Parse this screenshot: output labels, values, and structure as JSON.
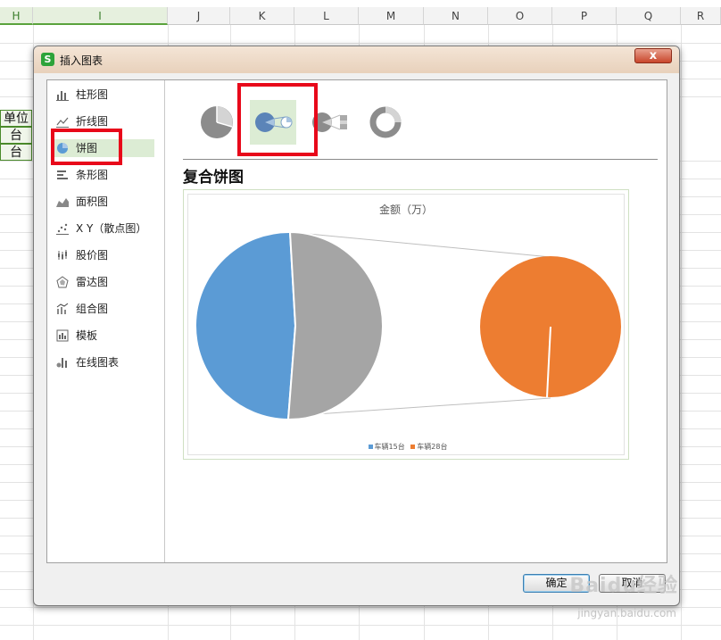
{
  "spreadsheet": {
    "columns": [
      "H",
      "I",
      "J",
      "K",
      "L",
      "M",
      "N",
      "O",
      "P",
      "Q",
      "R"
    ],
    "selected_columns": [
      "H",
      "I"
    ],
    "cells": [
      "单位",
      "台",
      "台"
    ]
  },
  "dialog": {
    "title": "插入图表",
    "app_icon": "S",
    "close_label": "x",
    "categories": [
      {
        "label": "柱形图",
        "icon": "column-chart-icon"
      },
      {
        "label": "折线图",
        "icon": "line-chart-icon"
      },
      {
        "label": "饼图",
        "icon": "pie-chart-icon",
        "selected": true
      },
      {
        "label": "条形图",
        "icon": "bar-chart-icon"
      },
      {
        "label": "面积图",
        "icon": "area-chart-icon"
      },
      {
        "label": "X Y（散点图）",
        "icon": "scatter-chart-icon"
      },
      {
        "label": "股价图",
        "icon": "stock-chart-icon"
      },
      {
        "label": "雷达图",
        "icon": "radar-chart-icon"
      },
      {
        "label": "组合图",
        "icon": "combo-chart-icon"
      },
      {
        "label": "模板",
        "icon": "template-icon"
      },
      {
        "label": "在线图表",
        "icon": "online-chart-icon"
      }
    ],
    "subtypes": [
      {
        "icon": "pie-icon"
      },
      {
        "icon": "pie-of-pie-icon",
        "selected": true
      },
      {
        "icon": "bar-of-pie-icon"
      },
      {
        "icon": "doughnut-icon"
      }
    ],
    "subtype_title": "复合饼图",
    "ok_label": "确定",
    "cancel_label": "取消"
  },
  "chart_data": {
    "type": "pie",
    "title": "金额（万）",
    "categories": [
      "车辆15台",
      "车辆28台"
    ],
    "colors": {
      "blue": "#5b9bd5",
      "gray": "#a5a5a5",
      "orange": "#ed7d31"
    },
    "legend_position": "bottom",
    "note": "pie-of-pie: main pie split blue/gray, gray 'other' slice expanded into secondary orange pie"
  },
  "watermark": {
    "text": "Baidu经验",
    "url": "jingyan.baidu.com"
  }
}
